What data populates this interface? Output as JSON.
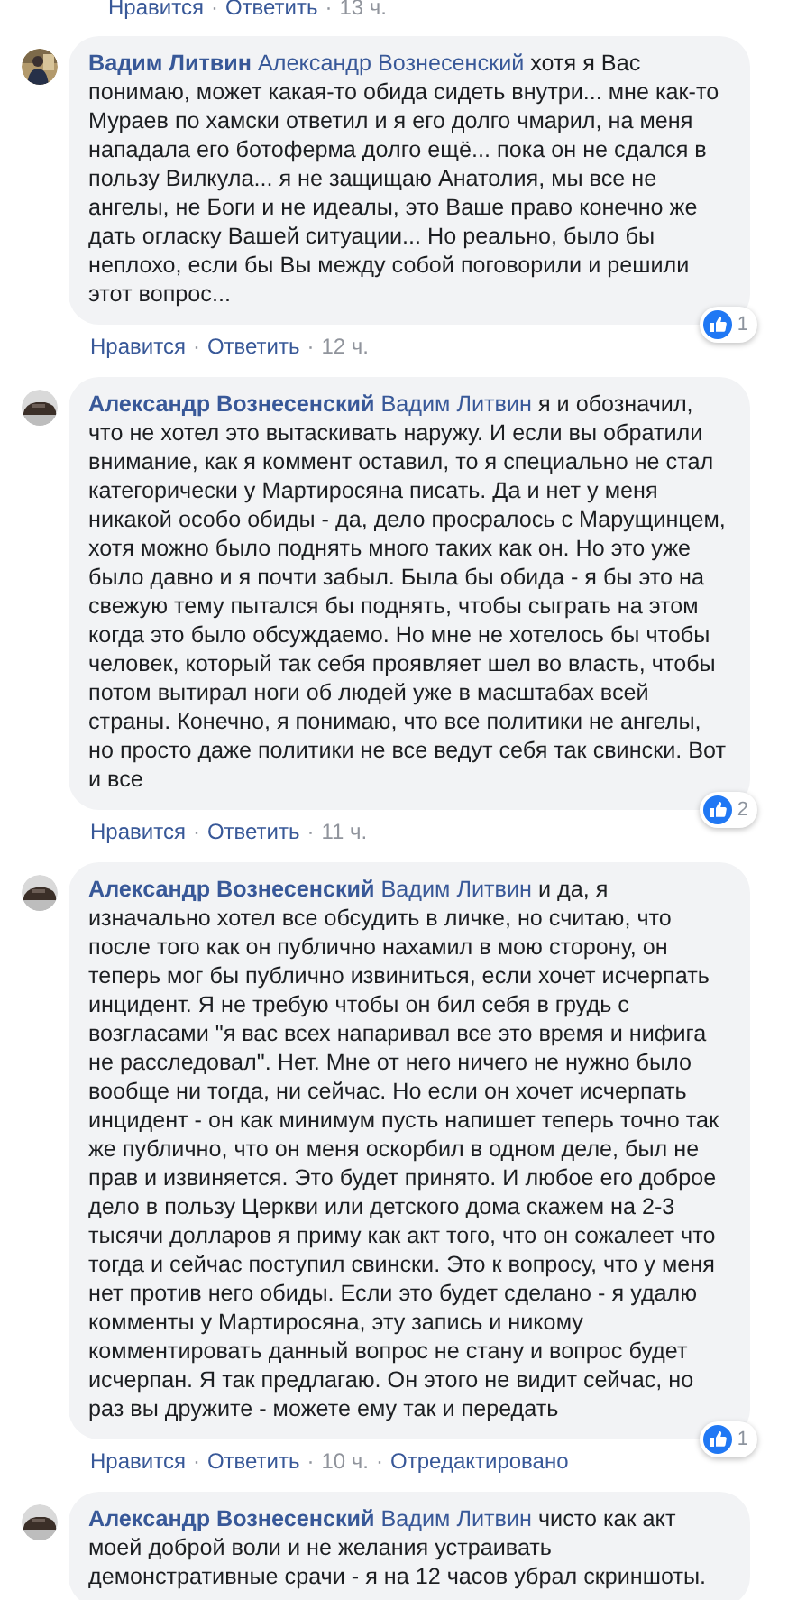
{
  "previous_comment_actions": [
    {
      "kind": "link",
      "text": "Нравится"
    },
    {
      "kind": "separator",
      "text": "·"
    },
    {
      "kind": "link",
      "text": "Ответить"
    },
    {
      "kind": "separator",
      "text": "·"
    },
    {
      "kind": "time",
      "text": "13 ч."
    }
  ],
  "comments": [
    {
      "author": "Вадим Литвин",
      "mention": "Александр Вознесенский",
      "text": "хотя я Вас понимаю, может какая-то обида сидеть внутри... мне как-то Мураев по хамски ответил и я его долго чмарил, на меня нападала его ботоферма долго ещё... пока он не сдался в пользу Вилкула... я не защищаю Анатолия, мы все не ангелы, не Боги и не идеалы, это Ваше право конечно же дать огласку Вашей ситуации... Но реально, было бы неплохо, если бы Вы между собой поговорили и решили этот вопрос...",
      "avatar": {
        "kind": "person"
      },
      "reactions": "1",
      "actions": [
        {
          "kind": "link",
          "text": "Нравится"
        },
        {
          "kind": "separator",
          "text": "·"
        },
        {
          "kind": "link",
          "text": "Ответить"
        },
        {
          "kind": "separator",
          "text": "·"
        },
        {
          "kind": "time",
          "text": "12 ч."
        }
      ]
    },
    {
      "author": "Александр Вознесенский",
      "mention": "Вадим Литвин",
      "text": "я и обозначил, что не хотел это вытаскивать наружу. И если вы обратили внимание, как я коммент оставил, то я специально не стал категорически у Мартиросяна писать. Да и нет у меня никакой особо обиды - да, дело просралось с Марущинцем, хотя можно было поднять много таких как он. Но это уже было давно и я почти забыл. Была бы обида - я бы это на свежую тему пытался бы поднять, чтобы сыграть на этом когда это было обсуждаемо. Но мне не хотелось бы чтобы человек, который так себя проявляет шел во власть, чтобы потом вытирал ноги об людей уже в масштабах всей страны. Конечно, я понимаю, что все политики не ангелы, но просто даже политики не все ведут себя так свински. Вот и все",
      "avatar": {
        "kind": "car"
      },
      "reactions": "2",
      "actions": [
        {
          "kind": "link",
          "text": "Нравится"
        },
        {
          "kind": "separator",
          "text": "·"
        },
        {
          "kind": "link",
          "text": "Ответить"
        },
        {
          "kind": "separator",
          "text": "·"
        },
        {
          "kind": "time",
          "text": "11 ч."
        }
      ]
    },
    {
      "author": "Александр Вознесенский",
      "mention": "Вадим Литвин",
      "text": "и да, я изначально хотел все обсудить в личке, но считаю, что после того как он публично нахамил в мою сторону, он теперь мог бы публично извиниться, если хочет исчерпать инцидент. Я не требую чтобы он бил себя в грудь с возгласами \"я вас всех напаривал все это время и нифига не расследовал\". Нет. Мне от него ничего не нужно было вообще ни тогда, ни сейчас. Но если он хочет исчерпать инцидент - он как минимум пусть напишет теперь точно так же публично, что он меня оскорбил в одном деле, был не прав и извиняется. Это будет принято. И любое его доброе дело в пользу Церкви или детского дома скажем на 2-3 тысячи долларов я приму как акт того, что он сожалеет что тогда и сейчас поступил свински. Это к вопросу, что у меня нет против него обиды. Если это будет сделано - я удалю комменты у Мартиросяна, эту запись и никому комментировать данный вопрос не стану и вопрос будет исчерпан. Я так предлагаю. Он этого не видит сейчас, но раз вы дружите - можете ему так и передать",
      "avatar": {
        "kind": "car"
      },
      "reactions": "1",
      "actions": [
        {
          "kind": "link",
          "text": "Нравится"
        },
        {
          "kind": "separator",
          "text": "·"
        },
        {
          "kind": "link",
          "text": "Ответить"
        },
        {
          "kind": "separator",
          "text": "·"
        },
        {
          "kind": "time",
          "text": "10 ч."
        },
        {
          "kind": "separator",
          "text": "·"
        },
        {
          "kind": "link",
          "text": "Отредактировано"
        }
      ]
    },
    {
      "author": "Александр Вознесенский",
      "mention": "Вадим Литвин",
      "text": "чисто как акт моей доброй воли и не желания устраивать демонстративные срачи - я на 12 часов убрал скриншоты.",
      "avatar": {
        "kind": "car"
      }
    }
  ]
}
